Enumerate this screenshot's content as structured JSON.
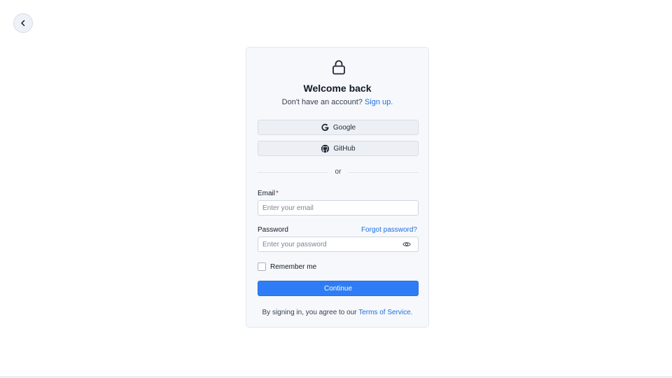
{
  "nav": {
    "back_icon": "chevron-left-icon"
  },
  "card": {
    "icon": "lock-icon",
    "title": "Welcome back",
    "subtitle_text": "Don't have an account?",
    "signup_link": "Sign up.",
    "google_label": "Google",
    "github_label": "GitHub",
    "divider_text": "or",
    "email": {
      "label": "Email",
      "required_mark": "*",
      "placeholder": "Enter your email",
      "value": ""
    },
    "password": {
      "label": "Password",
      "placeholder": "Enter your password",
      "value": "",
      "toggle_icon": "eye-icon"
    },
    "forgot_link": "Forgot password?",
    "remember_label": "Remember me",
    "remember_checked": false,
    "continue_label": "Continue",
    "terms_text": "By signing in, you agree to our",
    "terms_link": "Terms of Service."
  },
  "colors": {
    "accent": "#2f7df6",
    "link": "#1d6fe0",
    "required": "#dc2626"
  }
}
